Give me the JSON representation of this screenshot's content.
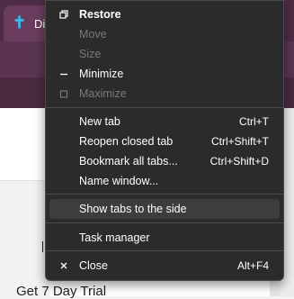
{
  "background": {
    "tab_icon": "✝",
    "tab_title": "Dig",
    "page_text": "Get 7 Day Trial"
  },
  "menu": {
    "items": [
      {
        "label": "Restore",
        "icon": "restore-icon"
      },
      {
        "label": "Move"
      },
      {
        "label": "Size"
      },
      {
        "label": "Minimize",
        "icon": "minimize-icon"
      },
      {
        "label": "Maximize",
        "icon": "maximize-icon"
      },
      {
        "label": "New tab",
        "shortcut": "Ctrl+T"
      },
      {
        "label": "Reopen closed tab",
        "shortcut": "Ctrl+Shift+T"
      },
      {
        "label": "Bookmark all tabs...",
        "shortcut": "Ctrl+Shift+D"
      },
      {
        "label": "Name window..."
      },
      {
        "label": "Show tabs to the side"
      },
      {
        "label": "Task manager"
      },
      {
        "label": "Close",
        "shortcut": "Alt+F4",
        "icon": "close-icon"
      }
    ]
  }
}
